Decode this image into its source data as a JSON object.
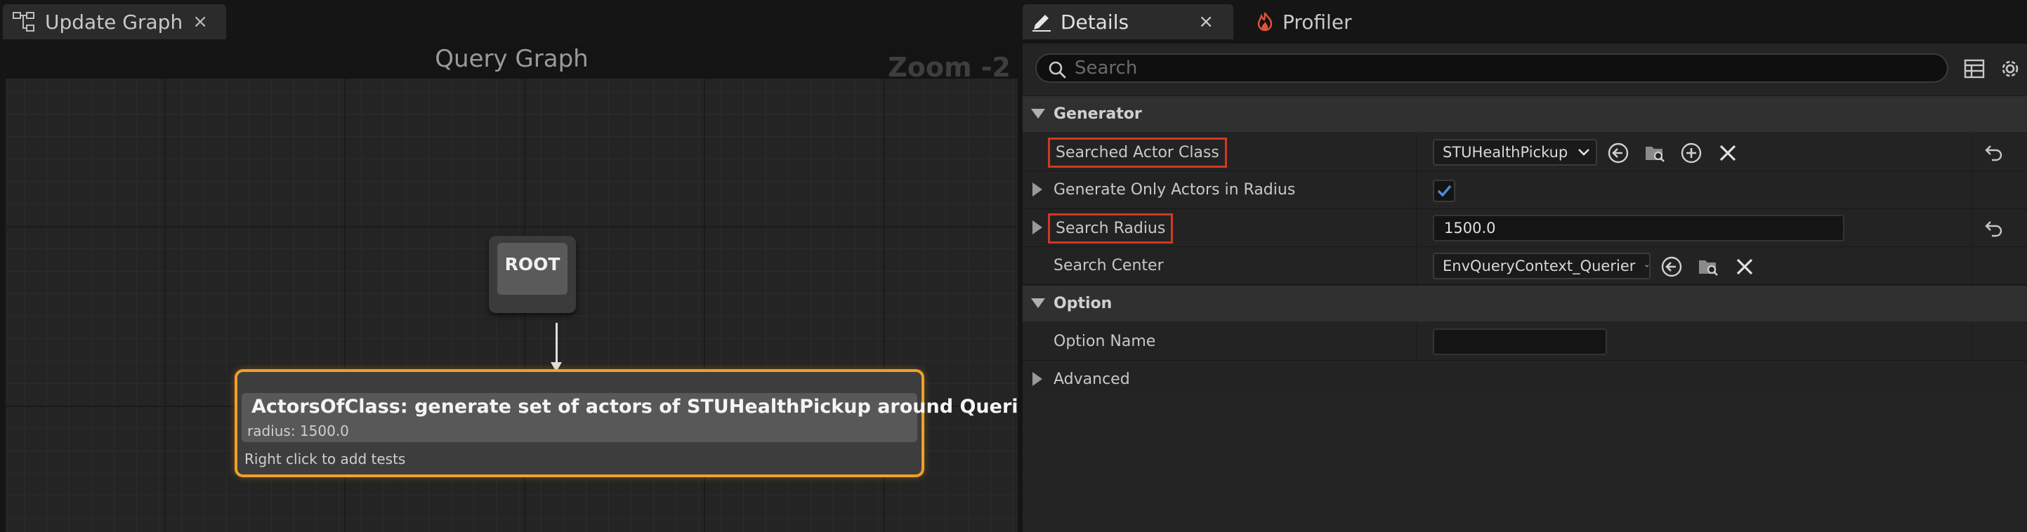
{
  "left_tab": {
    "label": "Update Graph",
    "close": "×"
  },
  "graph": {
    "title": "Query Graph",
    "zoom": "Zoom -2",
    "root_node": {
      "label": "ROOT"
    },
    "generator_node": {
      "title": "ActorsOfClass: generate set of actors of STUHealthPickup around Querier",
      "subtitle": "radius: 1500.0",
      "hint": "Right click to add tests",
      "border_color": "#f0a028"
    }
  },
  "right_tabs": {
    "details": {
      "label": "Details",
      "close": "×"
    },
    "profiler": {
      "label": "Profiler"
    }
  },
  "search": {
    "placeholder": "Search",
    "value": ""
  },
  "categories": {
    "generator": {
      "label": "Generator",
      "rows": {
        "searched_actor_class": {
          "name": "Searched Actor Class",
          "value": "STUHealthPickup",
          "highlighted": true
        },
        "generate_only_in_radius": {
          "name": "Generate Only Actors in Radius",
          "checked": true
        },
        "search_radius": {
          "name": "Search Radius",
          "value": "1500.0",
          "highlighted": true
        },
        "search_center": {
          "name": "Search Center",
          "value": "EnvQueryContext_Querier"
        }
      }
    },
    "option": {
      "label": "Option",
      "rows": {
        "option_name": {
          "name": "Option Name",
          "value": ""
        },
        "advanced": {
          "name": "Advanced"
        }
      }
    }
  },
  "colors": {
    "highlight_box": "#d03a22",
    "checkbox_check": "#4a8fe0",
    "node_border": "#f0a028",
    "panel_bg": "#242424",
    "category_bg": "#303030"
  }
}
